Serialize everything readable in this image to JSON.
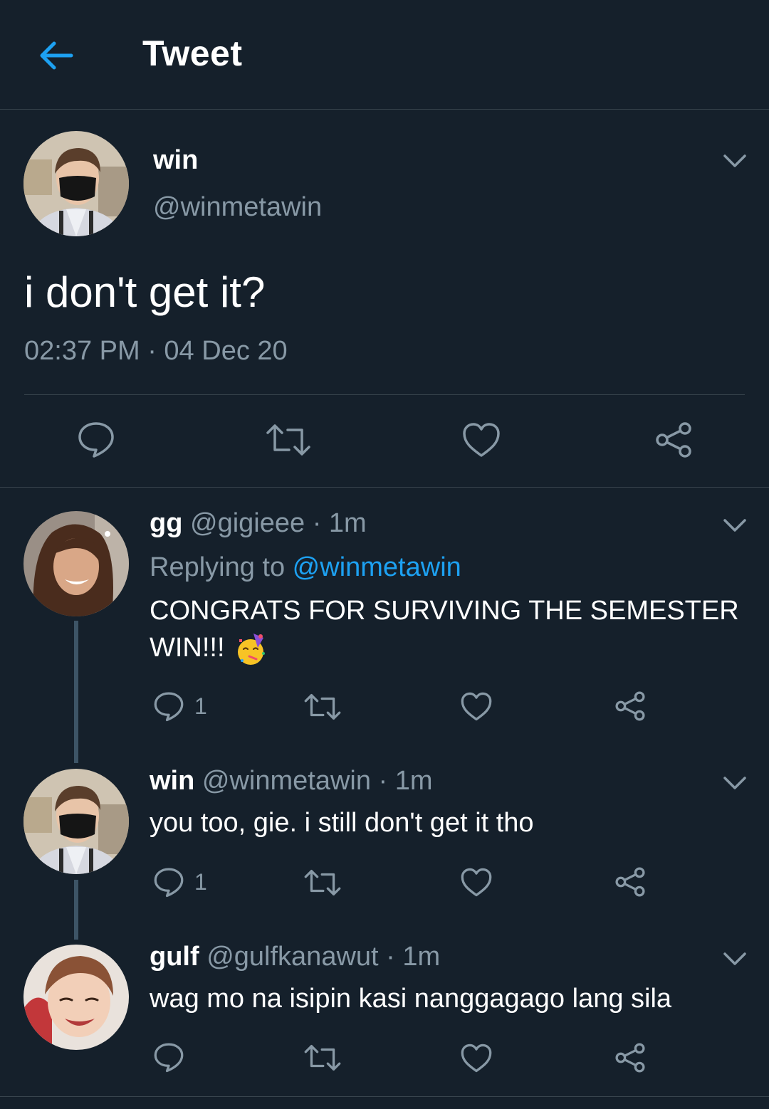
{
  "header": {
    "title": "Tweet"
  },
  "main_tweet": {
    "name": "win",
    "handle": "@winmetawin",
    "text": "i don't get it?",
    "timestamp": "02:37 PM · 04 Dec 20"
  },
  "replies": [
    {
      "name": "gg",
      "handle": "@gigieee",
      "sep": " · ",
      "time": "1m",
      "replying_label": "Replying to ",
      "replying_to": "@winmetawin",
      "text_line1": "CONGRATS FOR SURVIVING THE SEMESTER",
      "text_line2": "WIN!!!",
      "emoji": "partying-face",
      "reply_count": "1"
    },
    {
      "name": "win",
      "handle": "@winmetawin",
      "sep": " · ",
      "time": "1m",
      "text_line1": "you too, gie. i still don't get it tho",
      "reply_count": "1"
    },
    {
      "name": "gulf",
      "handle": "@gulfkanawut",
      "sep": " · ",
      "time": "1m",
      "text_line1": "wag mo na isipin kasi nanggagago lang sila",
      "reply_count": ""
    }
  ],
  "colors": {
    "background": "#15202b",
    "divider": "#38444d",
    "secondary_text": "#8899a6",
    "accent": "#1da1f2",
    "thread_line": "#3d5466"
  },
  "icons": [
    "back-arrow-icon",
    "chevron-down-icon",
    "reply-icon",
    "retweet-icon",
    "like-icon",
    "share-icon"
  ]
}
